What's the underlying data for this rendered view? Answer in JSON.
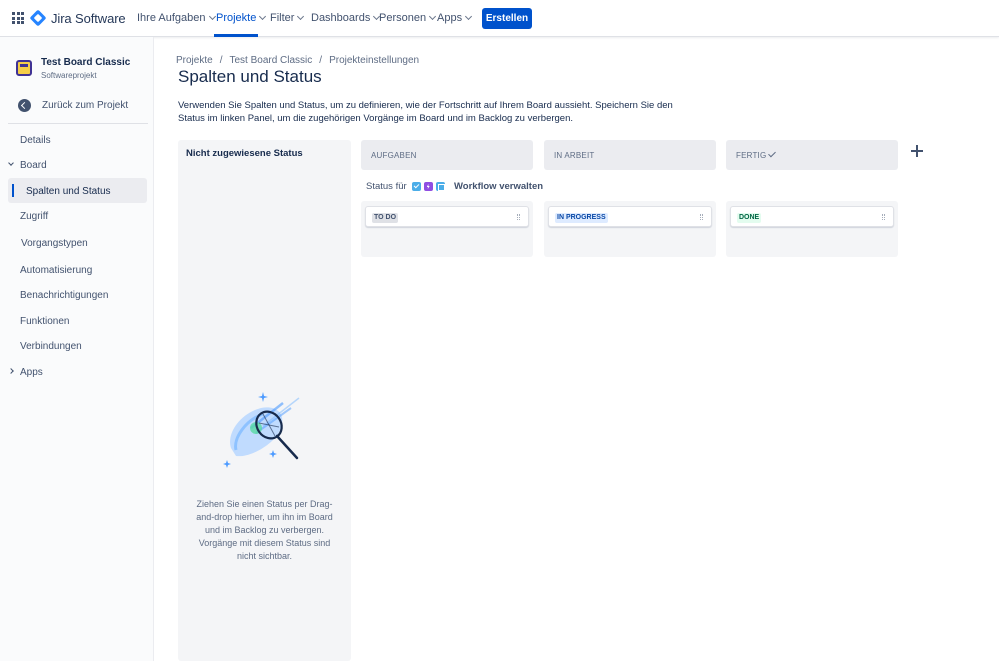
{
  "topnav": {
    "logo_text": "Jira Software",
    "items": [
      {
        "label": "Ihre Aufgaben"
      },
      {
        "label": "Projekte"
      },
      {
        "label": "Filter"
      },
      {
        "label": "Dashboards"
      },
      {
        "label": "Personen"
      },
      {
        "label": "Apps"
      }
    ],
    "create_label": "Erstellen",
    "accent_color": "#0052CC"
  },
  "sidebar": {
    "project_name": "Test Board Classic",
    "project_type": "Softwareprojekt",
    "back_label": "Zurück zum Projekt",
    "items": [
      {
        "label": "Details"
      },
      {
        "label": "Board"
      },
      {
        "label": "Spalten und Status"
      },
      {
        "label": "Zugriff"
      },
      {
        "label": "Vorgangstypen"
      },
      {
        "label": "Automatisierung"
      },
      {
        "label": "Benachrichtigungen"
      },
      {
        "label": "Funktionen"
      },
      {
        "label": "Verbindungen"
      },
      {
        "label": "Apps"
      }
    ]
  },
  "main": {
    "breadcrumb": [
      "Projekte",
      "Test Board Classic",
      "Projekteinstellungen"
    ],
    "title": "Spalten und Status",
    "description": "Verwenden Sie Spalten und Status, um zu definieren, wie der Fortschritt auf Ihrem Board aussieht. Speichern Sie den Status im linken Panel, um die zugehörigen Vorgänge im Board und im Backlog zu verbergen.",
    "unassigned": {
      "title": "Nicht zugewiesene Status",
      "empty_text": "Ziehen Sie einen Status per Drag-and-drop hierher, um ihn im Board und im Backlog zu verbergen. Vorgänge mit diesem Status sind nicht sichtbar."
    },
    "status_for_label": "Status für",
    "workflow_label": "Workflow verwalten",
    "columns": [
      {
        "name": "AUFGABEN",
        "status": "TO DO"
      },
      {
        "name": "IN ARBEIT",
        "status": "IN PROGRESS"
      },
      {
        "name": "FERTIG",
        "status": "DONE"
      }
    ]
  }
}
